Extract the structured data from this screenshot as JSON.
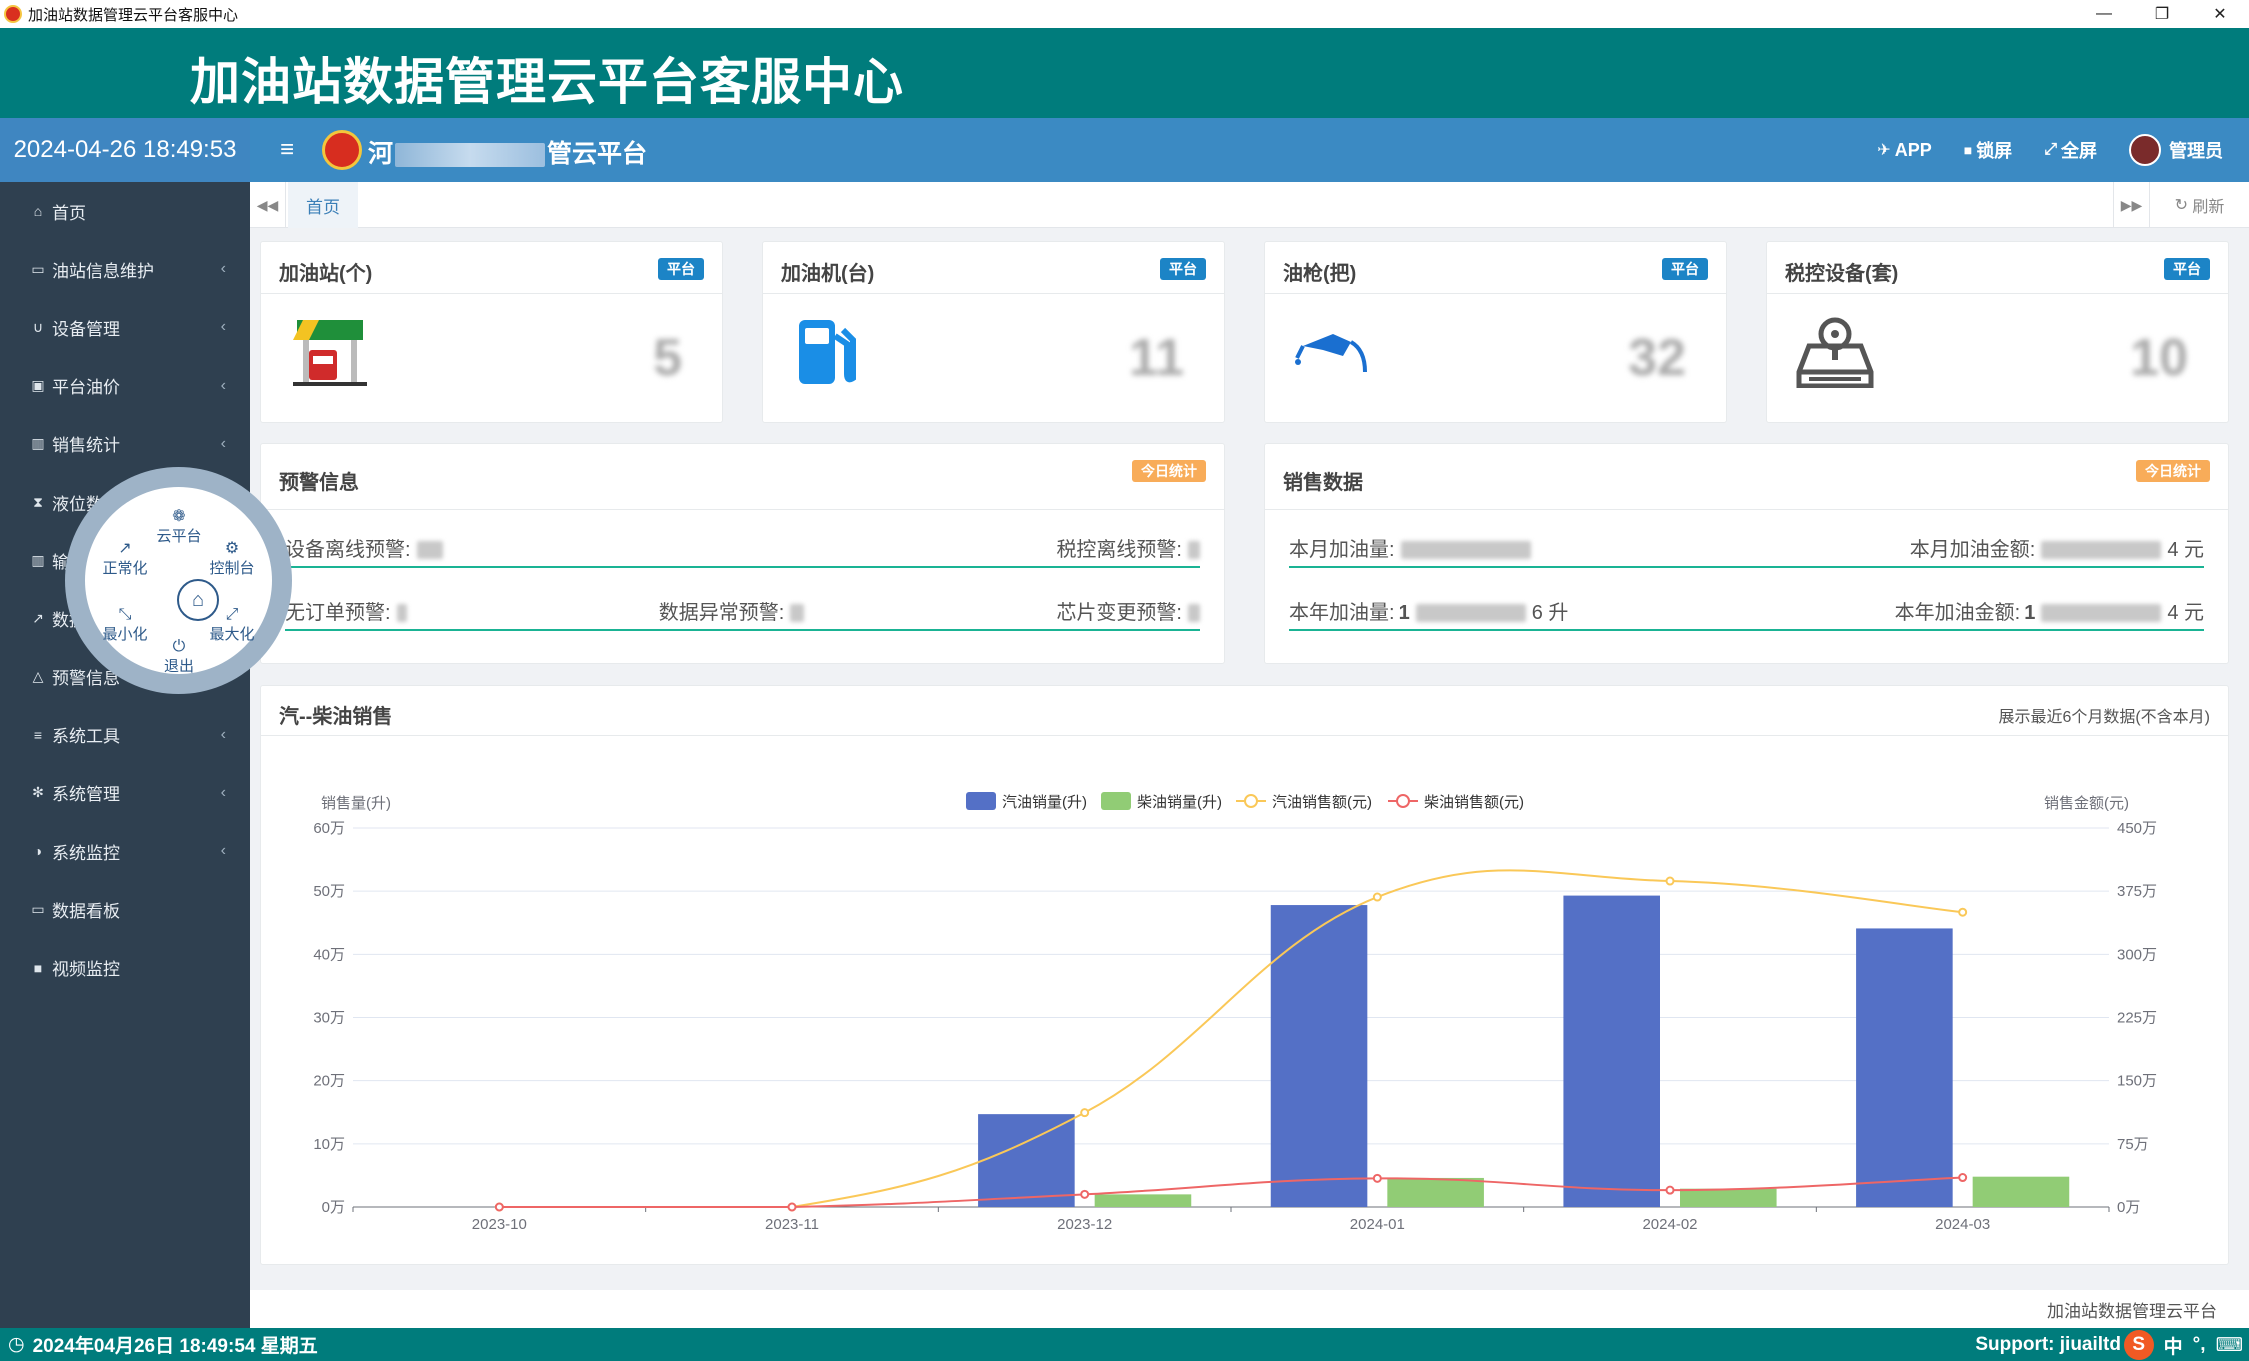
{
  "window": {
    "title": "加油站数据管理云平台客服中心",
    "controls": [
      "—",
      "❐",
      "✕"
    ]
  },
  "banner": {
    "title": "加油站数据管理云平台客服中心"
  },
  "sidebar": {
    "clock": "2024-04-26 18:49:53",
    "items": [
      {
        "label": "首页",
        "icon": "home-icon",
        "glyph": "⌂",
        "has_children": false
      },
      {
        "label": "油站信息维护",
        "icon": "credit-card-icon",
        "glyph": "▭",
        "has_children": true
      },
      {
        "label": "设备管理",
        "icon": "magnet-icon",
        "glyph": "∪",
        "has_children": true
      },
      {
        "label": "平台油价",
        "icon": "money-icon",
        "glyph": "▣",
        "has_children": true
      },
      {
        "label": "销售统计",
        "icon": "bar-chart-icon",
        "glyph": "▥",
        "has_children": true
      },
      {
        "label": "液位数据",
        "icon": "hourglass-icon",
        "glyph": "⧗",
        "has_children": true
      },
      {
        "label": "输油统计",
        "icon": "bar-chart-icon",
        "glyph": "▥",
        "has_children": true
      },
      {
        "label": "数据分析",
        "icon": "line-chart-icon",
        "glyph": "↗",
        "has_children": true
      },
      {
        "label": "预警信息",
        "icon": "bell-icon",
        "glyph": "△",
        "has_children": false
      },
      {
        "label": "系统工具",
        "icon": "bars-icon",
        "glyph": "≡",
        "has_children": true
      },
      {
        "label": "系统管理",
        "icon": "gear-icon",
        "glyph": "✻",
        "has_children": true
      },
      {
        "label": "系统监控",
        "icon": "adjust-icon",
        "glyph": "◑",
        "has_children": true
      },
      {
        "label": "数据看板",
        "icon": "desktop-icon",
        "glyph": "▭",
        "has_children": false
      },
      {
        "label": "视频监控",
        "icon": "video-camera-icon",
        "glyph": "■",
        "has_children": false
      }
    ],
    "chevron": "‹"
  },
  "topbar": {
    "menu_icon": "≡",
    "platform_prefix": "河",
    "platform_suffix": "管云平台",
    "actions": [
      {
        "label": "APP",
        "icon": "rocket-icon",
        "glyph": "✈"
      },
      {
        "label": "锁屏",
        "icon": "lock-icon",
        "glyph": "🔒"
      },
      {
        "label": "全屏",
        "icon": "expand-icon",
        "glyph": "⤢"
      }
    ],
    "user": "管理员"
  },
  "tabs": {
    "prev": "◀◀",
    "home": "首页",
    "next": "▶▶",
    "refresh": "刷新",
    "refresh_glyph": "↻"
  },
  "stat_cards": [
    {
      "title": "加油站(个)",
      "badge": "平台",
      "value": "5",
      "icon": "gas-station-icon"
    },
    {
      "title": "加油机(台)",
      "badge": "平台",
      "value": "11",
      "icon": "fuel-pump-icon"
    },
    {
      "title": "油枪(把)",
      "badge": "平台",
      "value": "32",
      "icon": "fuel-nozzle-icon"
    },
    {
      "title": "税控设备(套)",
      "badge": "平台",
      "value": "10",
      "icon": "tax-device-icon"
    }
  ],
  "warning_panel": {
    "title": "预警信息",
    "badge": "今日统计",
    "row1": [
      {
        "label": "设备离线预警:"
      },
      {
        "label": "税控离线预警:"
      }
    ],
    "row2": [
      {
        "label": "无订单预警:"
      },
      {
        "label": "数据异常预警:"
      },
      {
        "label": "芯片变更预警:"
      }
    ]
  },
  "sales_panel": {
    "title": "销售数据",
    "badge": "今日统计",
    "month_qty_label": "本月加油量:",
    "month_amt_label": "本月加油金额:",
    "month_amt_tail": "4 元",
    "year_qty_label": "本年加油量:",
    "year_qty_head": "1",
    "year_qty_tail": "6 升",
    "year_amt_label": "本年加油金额:",
    "year_amt_head": "1",
    "year_amt_tail": "4 元"
  },
  "chart_panel": {
    "title": "汽--柴油销售",
    "note": "展示最近6个月数据(不含本月)"
  },
  "chart_data": {
    "type": "bar",
    "categories": [
      "2023-10",
      "2023-11",
      "2023-12",
      "2024-01",
      "2024-02",
      "2024-03"
    ],
    "ylabel_left": "销售量(升)",
    "ylabel_right": "销售金额(元)",
    "ylim_left": [
      0,
      600000
    ],
    "ylim_right": [
      0,
      4500000
    ],
    "yticks_left": [
      "0万",
      "10万",
      "20万",
      "30万",
      "40万",
      "50万",
      "60万"
    ],
    "yticks_right": [
      "0万",
      "75万",
      "150万",
      "225万",
      "300万",
      "375万",
      "450万"
    ],
    "series": [
      {
        "name": "汽油销量(升)",
        "kind": "bar",
        "axis": "left",
        "color": "#5470c6",
        "values": [
          0,
          0,
          147000,
          478000,
          493000,
          441000
        ]
      },
      {
        "name": "柴油销量(升)",
        "kind": "bar",
        "axis": "left",
        "color": "#91cc75",
        "values": [
          0,
          0,
          20000,
          46000,
          29000,
          48000
        ]
      },
      {
        "name": "汽油销售额(元)",
        "kind": "line",
        "axis": "right",
        "color": "#fac858",
        "values": [
          0,
          0,
          1120000,
          3680000,
          3870000,
          3500000
        ]
      },
      {
        "name": "柴油销售额(元)",
        "kind": "line",
        "axis": "right",
        "color": "#ee6666",
        "values": [
          0,
          0,
          150000,
          340000,
          200000,
          350000
        ]
      }
    ],
    "legend_position": "top-center",
    "grid": true
  },
  "footer": {
    "brand": "加油站数据管理云平台"
  },
  "statusbar": {
    "clock_icon": "◷",
    "datetime": "2024年04月26日 18:49:54 星期五",
    "support": "Support: jiuailtd",
    "ime": [
      "中",
      "°,",
      "⌨"
    ],
    "ime_logo": "S"
  },
  "radial_menu": {
    "center_glyph": "⌂",
    "options": [
      {
        "label": "云平台",
        "glyph": "❁",
        "icon": "cloud-platform-icon"
      },
      {
        "label": "正常化",
        "glyph": "↗",
        "icon": "restore-icon"
      },
      {
        "label": "控制台",
        "glyph": "⚙",
        "icon": "console-gear-icon"
      },
      {
        "label": "最小化",
        "glyph": "⤡",
        "icon": "minimize-icon"
      },
      {
        "label": "最大化",
        "glyph": "⤢",
        "icon": "maximize-icon"
      },
      {
        "label": "退出",
        "glyph": "⏻",
        "icon": "power-icon"
      }
    ]
  }
}
